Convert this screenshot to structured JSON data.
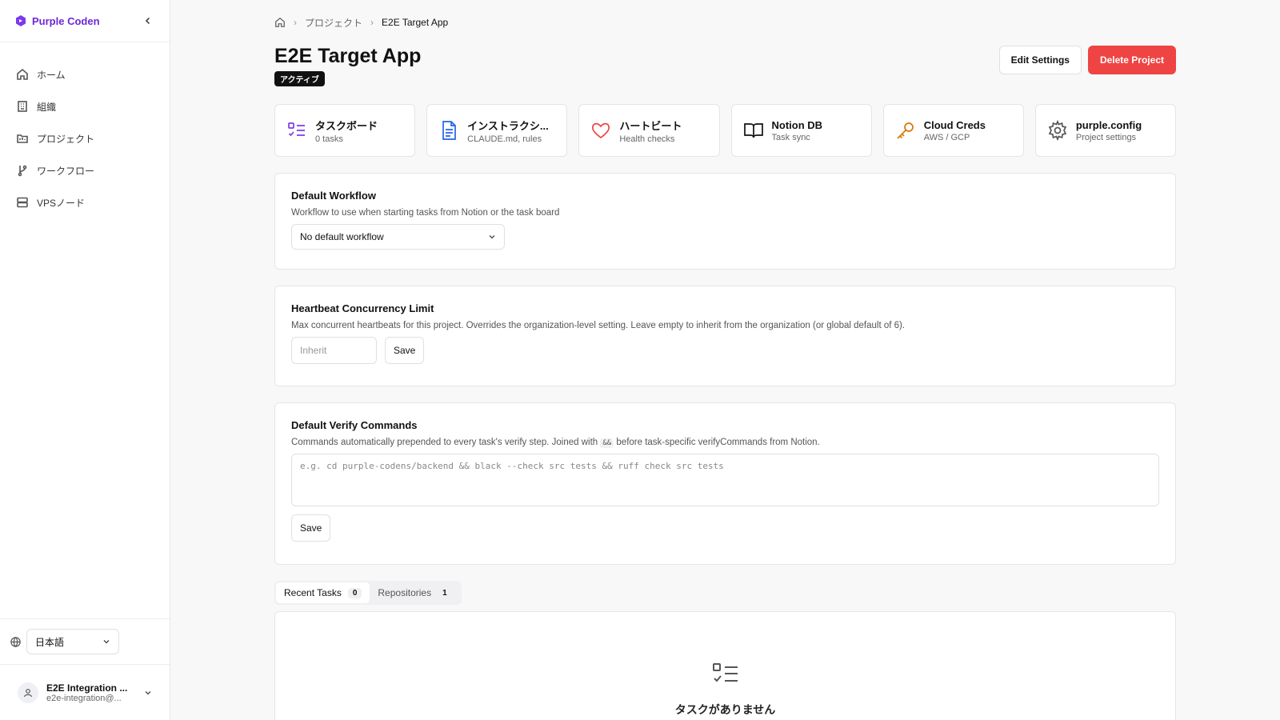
{
  "sidebar": {
    "brand": "Purple Coden",
    "items": [
      {
        "label": "ホーム",
        "icon": "home-icon"
      },
      {
        "label": "組織",
        "icon": "building-icon"
      },
      {
        "label": "プロジェクト",
        "icon": "folder-icon"
      },
      {
        "label": "ワークフロー",
        "icon": "git-branch-icon"
      },
      {
        "label": "VPSノード",
        "icon": "server-icon"
      }
    ],
    "language": "日本語",
    "user": {
      "name": "E2E Integration ...",
      "email": "e2e-integration@..."
    }
  },
  "breadcrumb": {
    "section": "プロジェクト",
    "current": "E2E Target App"
  },
  "header": {
    "title": "E2E Target App",
    "status": "アクティブ",
    "edit_label": "Edit Settings",
    "delete_label": "Delete Project"
  },
  "cards": [
    {
      "title": "タスクボード",
      "sub": "0 tasks",
      "icon": "list-check-icon",
      "color": "#7c3aed"
    },
    {
      "title": "インストラクシ...",
      "sub": "CLAUDE.md, rules",
      "icon": "document-icon",
      "color": "#2563eb"
    },
    {
      "title": "ハートビート",
      "sub": "Health checks",
      "icon": "heart-icon",
      "color": "#ef4444"
    },
    {
      "title": "Notion DB",
      "sub": "Task sync",
      "icon": "book-icon",
      "color": "#111111"
    },
    {
      "title": "Cloud Creds",
      "sub": "AWS / GCP",
      "icon": "key-icon",
      "color": "#d97706"
    },
    {
      "title": "purple.config",
      "sub": "Project settings",
      "icon": "gear-icon",
      "color": "#555555"
    }
  ],
  "workflow": {
    "title": "Default Workflow",
    "desc": "Workflow to use when starting tasks from Notion or the task board",
    "selected": "No default workflow"
  },
  "heartbeat": {
    "title": "Heartbeat Concurrency Limit",
    "desc": "Max concurrent heartbeats for this project. Overrides the organization-level setting. Leave empty to inherit from the organization (or global default of 6).",
    "placeholder": "Inherit",
    "save": "Save"
  },
  "verify": {
    "title": "Default Verify Commands",
    "desc_before": "Commands automatically prepended to every task's verify step. Joined with",
    "desc_code": "&&",
    "desc_after": "before task-specific verifyCommands from Notion.",
    "placeholder": "e.g. cd purple-codens/backend && black --check src tests && ruff check src tests",
    "save": "Save"
  },
  "tabs": [
    {
      "label": "Recent Tasks",
      "count": "0"
    },
    {
      "label": "Repositories",
      "count": "1"
    }
  ],
  "empty": {
    "text": "タスクがありません"
  }
}
